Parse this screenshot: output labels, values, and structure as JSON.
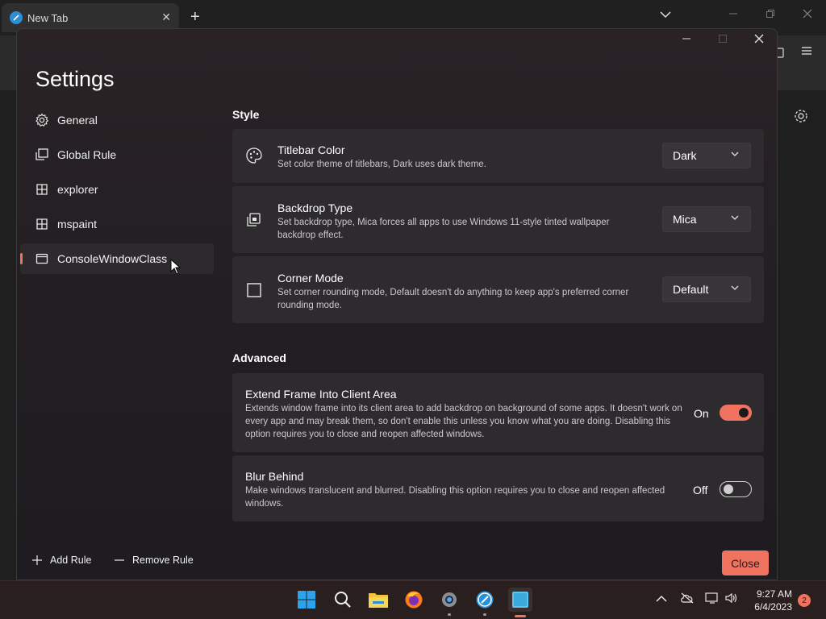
{
  "browser": {
    "tab_title": "New Tab",
    "tab_close": "✕",
    "new_tab": "+"
  },
  "window": {
    "title": "Settings"
  },
  "nav": {
    "items": [
      {
        "label": "General",
        "icon": "gear-icon"
      },
      {
        "label": "Global Rule",
        "icon": "windows-stack-icon"
      },
      {
        "label": "explorer",
        "icon": "window-rule-icon"
      },
      {
        "label": "mspaint",
        "icon": "window-rule-icon"
      },
      {
        "label": "ConsoleWindowClass",
        "icon": "window-icon",
        "selected": true
      }
    ]
  },
  "style_section": {
    "header": "Style",
    "cards": [
      {
        "title": "Titlebar Color",
        "desc": "Set color theme of titlebars, Dark uses dark theme.",
        "value": "Dark",
        "icon": "palette-icon"
      },
      {
        "title": "Backdrop Type",
        "desc": "Set backdrop type, Mica forces all apps to use Windows 11-style tinted wallpaper backdrop effect.",
        "value": "Mica",
        "icon": "backdrop-icon"
      },
      {
        "title": "Corner Mode",
        "desc": "Set corner rounding mode, Default doesn't do anything to keep app's preferred corner rounding mode.",
        "value": "Default",
        "icon": "square-corner-icon"
      }
    ]
  },
  "advanced_section": {
    "header": "Advanced",
    "cards": [
      {
        "title": "Extend Frame Into Client Area",
        "desc": "Extends window frame into its client area to add backdrop on background of some apps. It doesn't work on every app and may break them, so don't enable this unless you know what you are doing. Disabling this option requires you to close and reopen affected windows.",
        "state": "On",
        "on": true
      },
      {
        "title": "Blur Behind",
        "desc": "Make windows translucent and blurred. Disabling this option requires you to close and reopen affected windows.",
        "state": "Off",
        "on": false
      }
    ]
  },
  "footer": {
    "add_rule": "Add Rule",
    "remove_rule": "Remove Rule",
    "close": "Close"
  },
  "taskbar": {
    "time": "9:27 AM",
    "date": "6/4/2023",
    "notifications": "2"
  },
  "colors": {
    "accent": "#f0735f"
  }
}
